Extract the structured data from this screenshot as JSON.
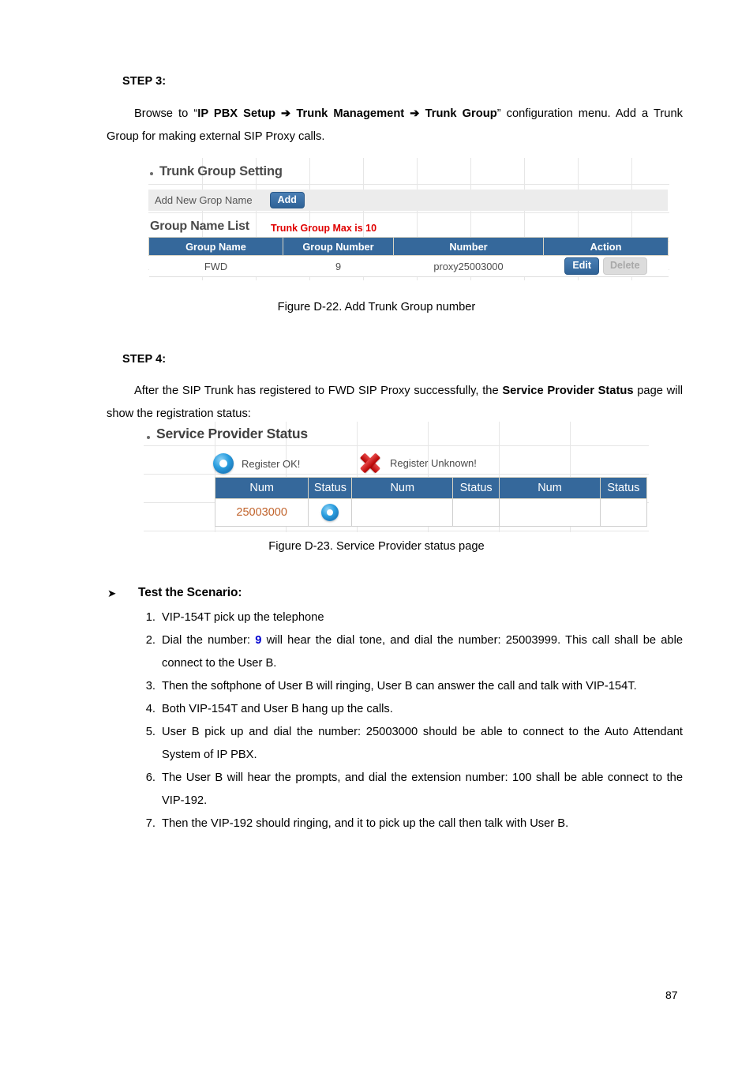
{
  "step3": {
    "label": "STEP 3:",
    "paragraph_pre": "Browse to “",
    "paragraph_bold": "IP PBX Setup ➔ Trunk Management ➔ Trunk Group",
    "paragraph_post": "” configuration menu. Add a Trunk Group for making external SIP Proxy calls."
  },
  "figure_d22": {
    "caption": "Figure D-22. Add Trunk Group number",
    "panel_title": "Trunk Group Setting",
    "add_row_label": "Add New Grop Name",
    "add_button": "Add",
    "list_title": "Group Name List",
    "list_max_note": "Trunk Group Max is 10",
    "columns": [
      "Group Name",
      "Group Number",
      "Number",
      "Action"
    ],
    "rows": [
      {
        "group_name": "FWD",
        "group_number": "9",
        "number": "proxy25003000",
        "edit_label": "Edit",
        "delete_label": "Delete"
      }
    ],
    "colors": {
      "header_blue": "#35689b",
      "button_blue": "#3a6ea5",
      "warning_red": "#e00000",
      "disabled_grey": "#dcdcdc"
    }
  },
  "step4": {
    "label": "STEP 4:",
    "paragraph_pre": "After the SIP Trunk has registered to FWD SIP Proxy successfully, the ",
    "paragraph_bold": "Service Provider Status",
    "paragraph_post": " page will show the registration status:"
  },
  "figure_d23": {
    "caption": "Figure D-23. Service Provider status page",
    "panel_title": "Service Provider Status",
    "legend": [
      {
        "icon": "blue-ring-icon",
        "label": "Register OK!"
      },
      {
        "icon": "red-x-icon",
        "label": "Register Unknown!"
      }
    ],
    "columns": [
      "Num",
      "Status",
      "Num",
      "Status",
      "Num",
      "Status"
    ],
    "rows": [
      {
        "num": "25003000",
        "status_icon": "blue-ring-icon",
        "num2": "",
        "status2": "",
        "num3": "",
        "status3": ""
      }
    ],
    "colors": {
      "header_blue": "#35689b",
      "num_text": "#c0622a"
    }
  },
  "scenario": {
    "arrow": "➤",
    "heading": "Test the Scenario:",
    "items": [
      {
        "n": "1.",
        "pre": "VIP-154T pick up the telephone",
        "hl": "",
        "post": ""
      },
      {
        "n": "2.",
        "pre": "Dial the number: ",
        "hl": "9",
        "post": " will hear the dial tone, and dial the number: 25003999. This call shall be able connect to the User B."
      },
      {
        "n": "3.",
        "pre": "Then the softphone of User B will ringing, User B can answer the call and talk with VIP-154T.",
        "hl": "",
        "post": ""
      },
      {
        "n": "4.",
        "pre": "Both VIP-154T and User B hang up the calls.",
        "hl": "",
        "post": ""
      },
      {
        "n": "5.",
        "pre": "User B pick up and dial the number: 25003000 should be able to connect to the Auto Attendant System of IP PBX.",
        "hl": "",
        "post": ""
      },
      {
        "n": "6.",
        "pre": "The User B will hear the prompts, and dial the extension number: 100 shall be able connect to the VIP-192.",
        "hl": "",
        "post": ""
      },
      {
        "n": "7.",
        "pre": "Then the VIP-192 should ringing, and it to pick up the call then talk with User B.",
        "hl": "",
        "post": ""
      }
    ]
  },
  "footer": {
    "page_number": "87"
  }
}
